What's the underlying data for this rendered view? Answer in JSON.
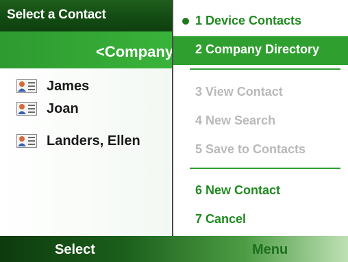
{
  "title": "Select a Contact",
  "filter": "<Company",
  "contacts": [
    {
      "name": "James"
    },
    {
      "name": "Joan"
    },
    {
      "name": "Landers, Ellen"
    }
  ],
  "menu": {
    "items": [
      {
        "label": "1 Device Contacts",
        "state": "active",
        "checked": true
      },
      {
        "label": "2 Company Directory",
        "state": "selected"
      },
      {
        "label": "3 View Contact",
        "state": "disabled"
      },
      {
        "label": "4 New Search",
        "state": "disabled"
      },
      {
        "label": "5 Save to Contacts",
        "state": "disabled"
      },
      {
        "label": "6 New Contact",
        "state": "active"
      },
      {
        "label": "7 Cancel",
        "state": "active"
      }
    ]
  },
  "softkeys": {
    "left": "Select",
    "right": "Menu"
  },
  "colors": {
    "accent": "#2f9f2f",
    "title_bar": "#124a12",
    "disabled_text": "#b9b9b9"
  },
  "icons": {
    "contact": "contact-card-icon",
    "checked": "radio-bullet-icon"
  }
}
